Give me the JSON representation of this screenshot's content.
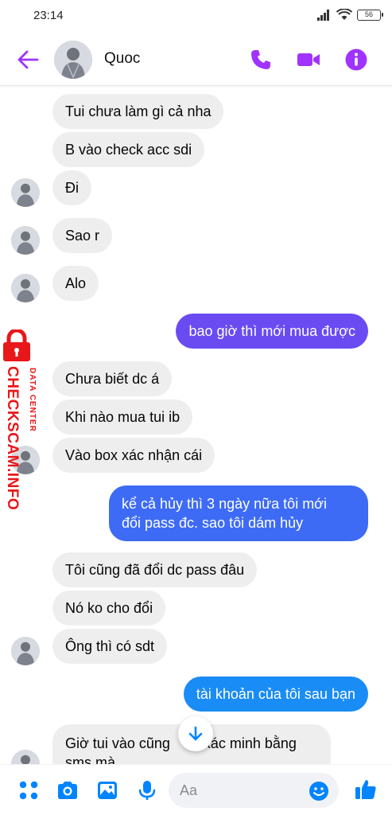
{
  "status": {
    "time": "23:14",
    "battery": "56"
  },
  "header": {
    "contact_name": "Quoc"
  },
  "colors": {
    "accent": "#a033ff",
    "messenger_blue": "#0084ff",
    "incoming_bg": "#eeeeee"
  },
  "messages": [
    {
      "dir": "in",
      "text": "Tui chưa làm gì cả nha"
    },
    {
      "dir": "in",
      "text": "B vào check acc sdi"
    },
    {
      "dir": "in",
      "text": "Đi"
    },
    {
      "dir": "in",
      "text": "Sao r"
    },
    {
      "dir": "in",
      "text": "Alo"
    },
    {
      "dir": "out",
      "text": "bao giờ thì mới mua được"
    },
    {
      "dir": "in",
      "text": "Chưa biết dc á"
    },
    {
      "dir": "in",
      "text": "Khi nào mua tui ib"
    },
    {
      "dir": "in",
      "text": "Vào box xác nhận cái"
    },
    {
      "dir": "out",
      "text": "kể cả hủy thì 3 ngày nữa tôi mới",
      "text2": "đổi pass đc. sao tôi dám hủy"
    },
    {
      "dir": "in",
      "text": "Tôi cũng đã đổi dc pass đâu"
    },
    {
      "dir": "in",
      "text": "Nó ko cho đổi"
    },
    {
      "dir": "in",
      "text": "Ông thì có sdt"
    },
    {
      "dir": "out",
      "text": "tài khoản của tôi sau bạn"
    },
    {
      "dir": "in",
      "text": "Giờ tui vào cũng",
      "text_b": "xác minh bằng",
      "text2": "sms mà"
    }
  ],
  "watermark": {
    "line1": "DATA CENTER",
    "line2": "CHECKSCAM.INFO"
  },
  "composer": {
    "placeholder": "Aa"
  },
  "icons": [
    "back-arrow-icon",
    "phone-icon",
    "video-camera-icon",
    "info-icon",
    "menu-dots-icon",
    "camera-icon",
    "image-icon",
    "microphone-icon",
    "emoji-icon",
    "thumbs-up-icon",
    "arrow-down-icon"
  ]
}
